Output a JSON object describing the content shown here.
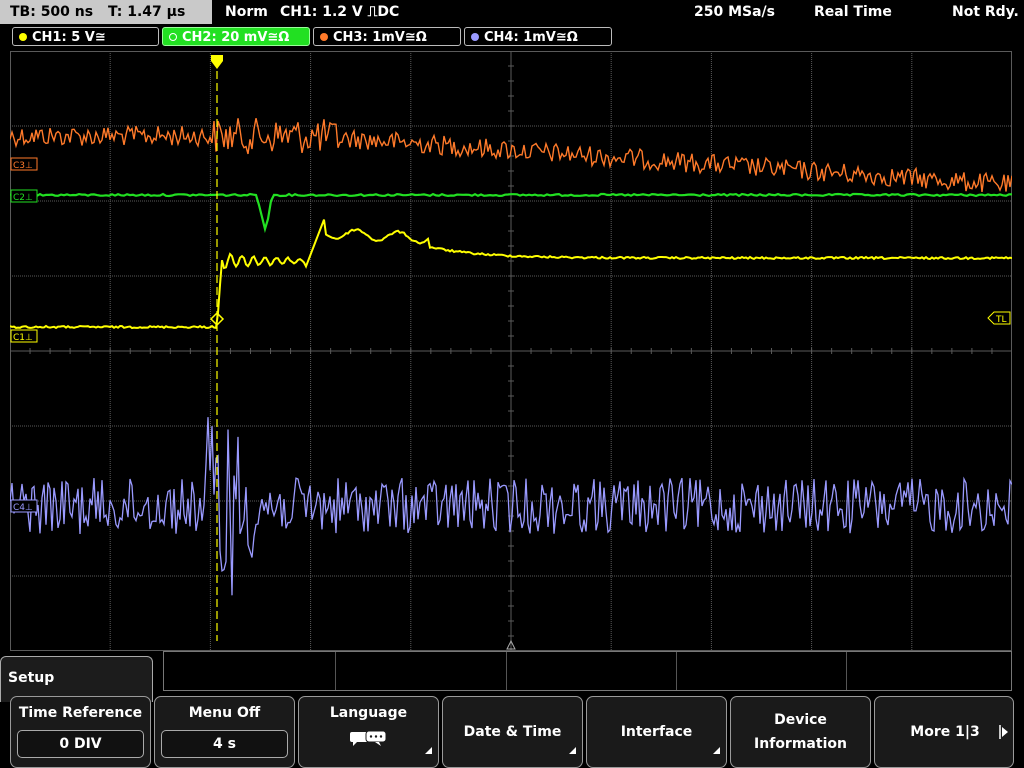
{
  "status_bar": {
    "timebase": "TB: 500 ns",
    "trigger_time": "T: 1.47 µs",
    "mode": "Norm",
    "trigger_info": "CH1: 1.2 V ⎍DC",
    "sample_rate": "250 MSa/s",
    "acquisition": "Real Time",
    "state": "Not Rdy."
  },
  "channel_tabs": [
    {
      "label": "CH1: 5 V≅",
      "color": "#ffff00"
    },
    {
      "label": "CH2: 20 mV≅Ω",
      "color": "#22e022"
    },
    {
      "label": "CH3: 1mV≅Ω",
      "color": "#ff7a2a"
    },
    {
      "label": "CH4: 1mV≅Ω",
      "color": "#9a9aff"
    }
  ],
  "markers": {
    "c3": "C3⊥",
    "c2": "C2⊥",
    "c1": "C1⊥",
    "c4": "C4⊥",
    "trigger_level": "TL"
  },
  "menu": {
    "title": "Setup",
    "softkeys": [
      {
        "title": "Time Reference",
        "value": "0 DIV"
      },
      {
        "title": "Menu Off",
        "value": "4 s"
      },
      {
        "title": "Language",
        "icon": "speech-bubble-icon"
      },
      {
        "title": "Date & Time"
      },
      {
        "title": "Interface"
      },
      {
        "title_line1": "Device",
        "title_line2": "Information"
      },
      {
        "title": "More 1|3",
        "icon": "arrow-right-icon"
      }
    ]
  },
  "colors": {
    "ch1": "#ffff00",
    "ch2": "#22e022",
    "ch3": "#ff7a2a",
    "ch4": "#9a9aff",
    "grid": "#5a5a5a"
  }
}
